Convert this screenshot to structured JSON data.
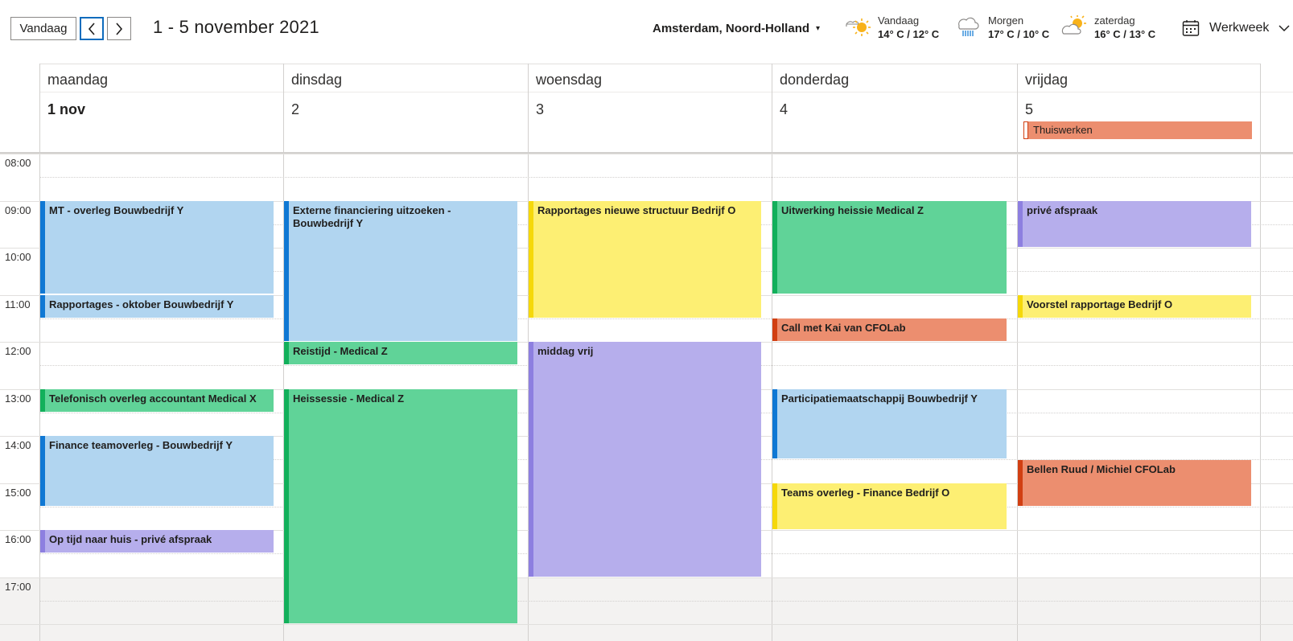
{
  "toolbar": {
    "today_label": "Vandaag",
    "prev_icon": "chevron-left-icon",
    "next_icon": "chevron-right-icon",
    "date_range": "1 - 5 november 2021"
  },
  "location": {
    "name": "Amsterdam, Noord-Holland",
    "caret": "▾"
  },
  "weather": [
    {
      "day": "Vandaag",
      "temp": "14° C / 12° C",
      "icon": "partly-sunny-icon"
    },
    {
      "day": "Morgen",
      "temp": "17° C / 10° C",
      "icon": "rain-cloud-icon"
    },
    {
      "day": "zaterdag",
      "temp": "16° C / 13° C",
      "icon": "partly-cloudy-icon"
    }
  ],
  "view": {
    "label": "Werkweek",
    "icon": "calendar-icon"
  },
  "days": [
    {
      "name": "maandag",
      "num": "1 nov"
    },
    {
      "name": "dinsdag",
      "num": "2"
    },
    {
      "name": "woensdag",
      "num": "3"
    },
    {
      "name": "donderdag",
      "num": "4"
    },
    {
      "name": "vrijdag",
      "num": "5"
    }
  ],
  "allday_events": [
    {
      "title": "Thuiswerken",
      "color": "#ec8e6f"
    }
  ],
  "hours": [
    "08:00",
    "09:00",
    "10:00",
    "11:00",
    "12:00",
    "13:00",
    "14:00",
    "15:00",
    "16:00",
    "17:00"
  ],
  "events": {
    "mon1": "MT - overleg Bouwbedrijf Y",
    "mon2": "Rapportages - oktober Bouwbedrijf Y",
    "mon3": "Telefonisch overleg accountant Medical X",
    "mon4": "Finance teamoverleg - Bouwbedrijf Y",
    "mon5": "Op tijd naar huis - privé afspraak",
    "tue1": "Externe financiering uitzoeken - Bouwbedrijf Y",
    "tue2": "Reistijd - Medical Z",
    "tue3": "Heissessie - Medical Z",
    "wed1": "Rapportages nieuwe structuur Bedrijf O",
    "wed2": "middag vrij",
    "thu1": "Uitwerking heissie Medical Z",
    "thu2": "Call met Kai van CFOLab",
    "thu3": "Participatiemaatschappij Bouwbedrijf Y",
    "thu4": "Teams overleg - Finance Bedrijf O",
    "fri1": "privé afspraak",
    "fri2": "Voorstel rapportage Bedrijf O",
    "fri3": "Bellen Ruud / Michiel CFOLab"
  },
  "colors": {
    "blue": "#b1d5f0",
    "green": "#60d398",
    "yellow": "#fdef73",
    "purple": "#b6aeec",
    "orange": "#ec8e6f",
    "accent": "#0f6cbd"
  }
}
